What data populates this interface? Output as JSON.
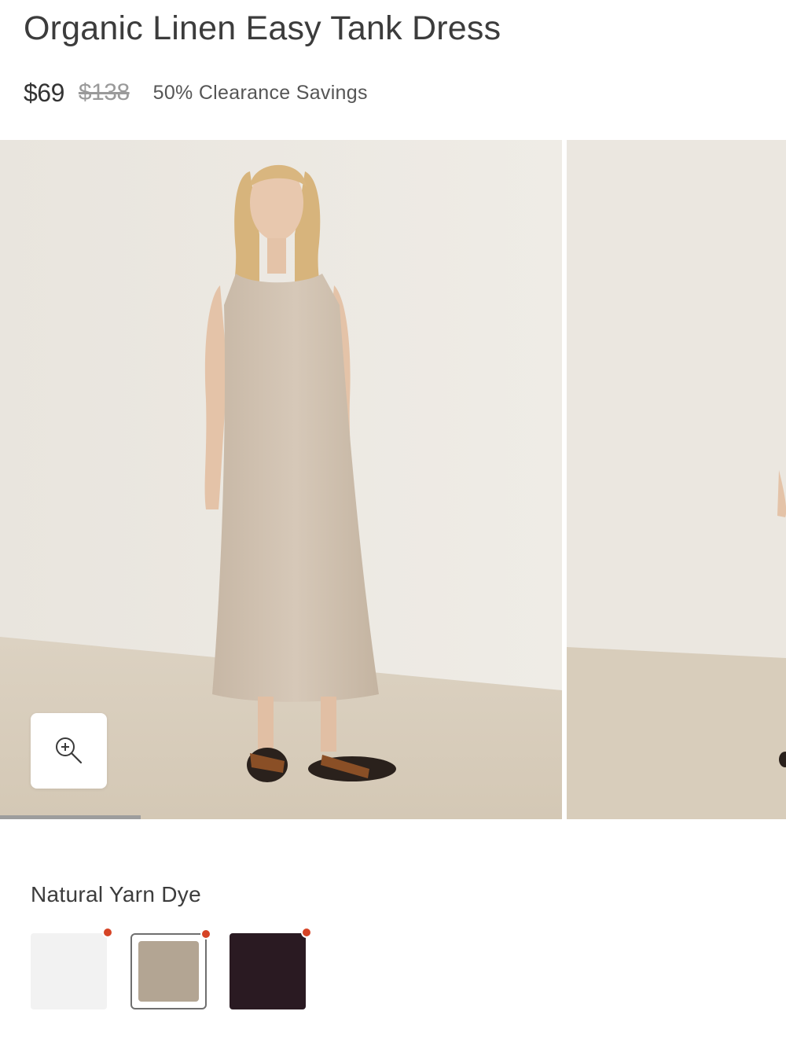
{
  "product": {
    "title": "Organic Linen Easy Tank Dress",
    "price_now": "$69",
    "price_was": "$138",
    "savings": "50% Clearance Savings"
  },
  "gallery": {
    "slide_count_visible": 2,
    "progress_fraction": 0.25,
    "zoom_icon": "zoom-in-icon"
  },
  "color": {
    "selected_name": "Natural Yarn Dye",
    "selected_index": 1,
    "swatches": [
      {
        "color": "#f2f2f2",
        "badge_color": "#d64426"
      },
      {
        "color": "#b3a593",
        "badge_color": "#d64426"
      },
      {
        "color": "#2a1a22",
        "badge_color": "#d64426"
      }
    ]
  }
}
